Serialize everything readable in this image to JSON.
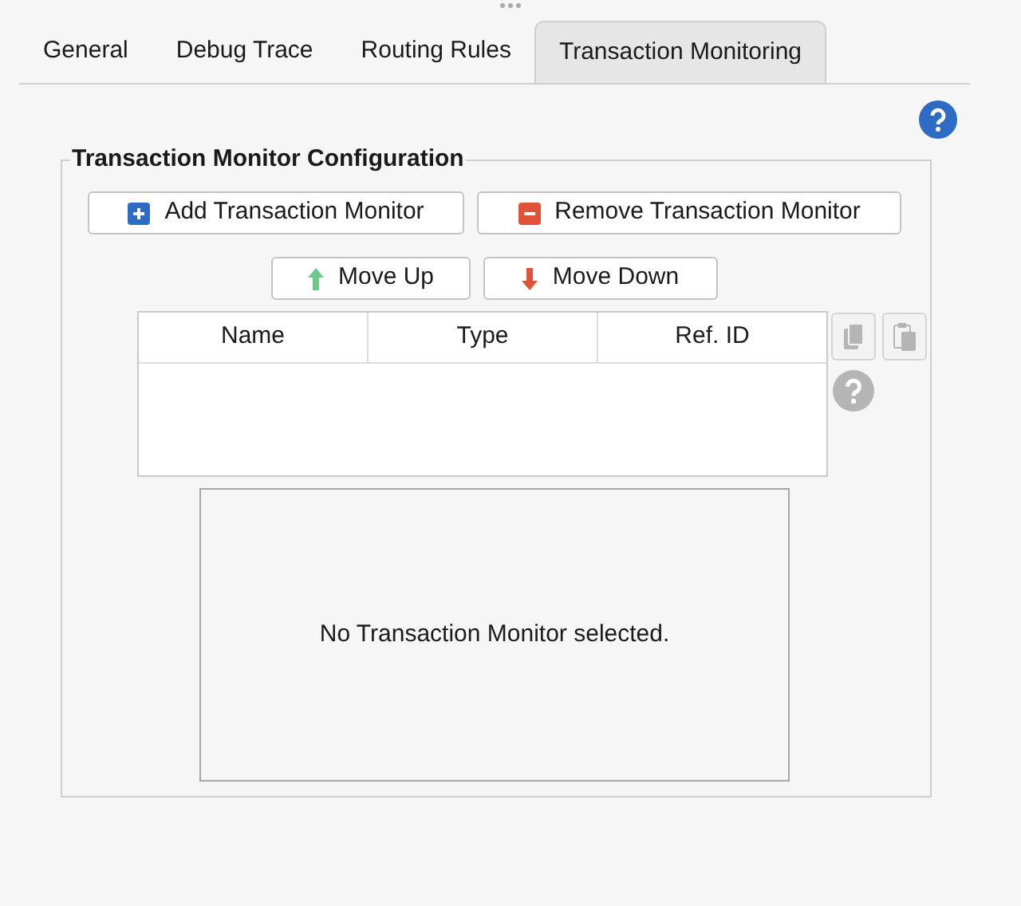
{
  "tabs": [
    {
      "label": "General",
      "selected": false
    },
    {
      "label": "Debug Trace",
      "selected": false
    },
    {
      "label": "Routing Rules",
      "selected": false
    },
    {
      "label": "Transaction Monitoring",
      "selected": true
    }
  ],
  "group": {
    "title": "Transaction Monitor Configuration",
    "buttons": [
      {
        "kind": "add",
        "label": "Add Transaction Monitor"
      },
      {
        "kind": "remove",
        "label": "Remove Transaction Monitor"
      }
    ],
    "move_buttons": [
      {
        "kind": "up",
        "label": "Move Up"
      },
      {
        "kind": "down",
        "label": "Move Down"
      }
    ],
    "table": {
      "columns": [
        "Name",
        "Type",
        "Ref. ID"
      ]
    },
    "side_buttons": [
      {
        "kind": "copy",
        "disabled": true
      },
      {
        "kind": "paste",
        "disabled": true
      },
      {
        "kind": "help",
        "disabled": true
      }
    ],
    "detail": {
      "message": "No Transaction Monitor selected."
    }
  }
}
